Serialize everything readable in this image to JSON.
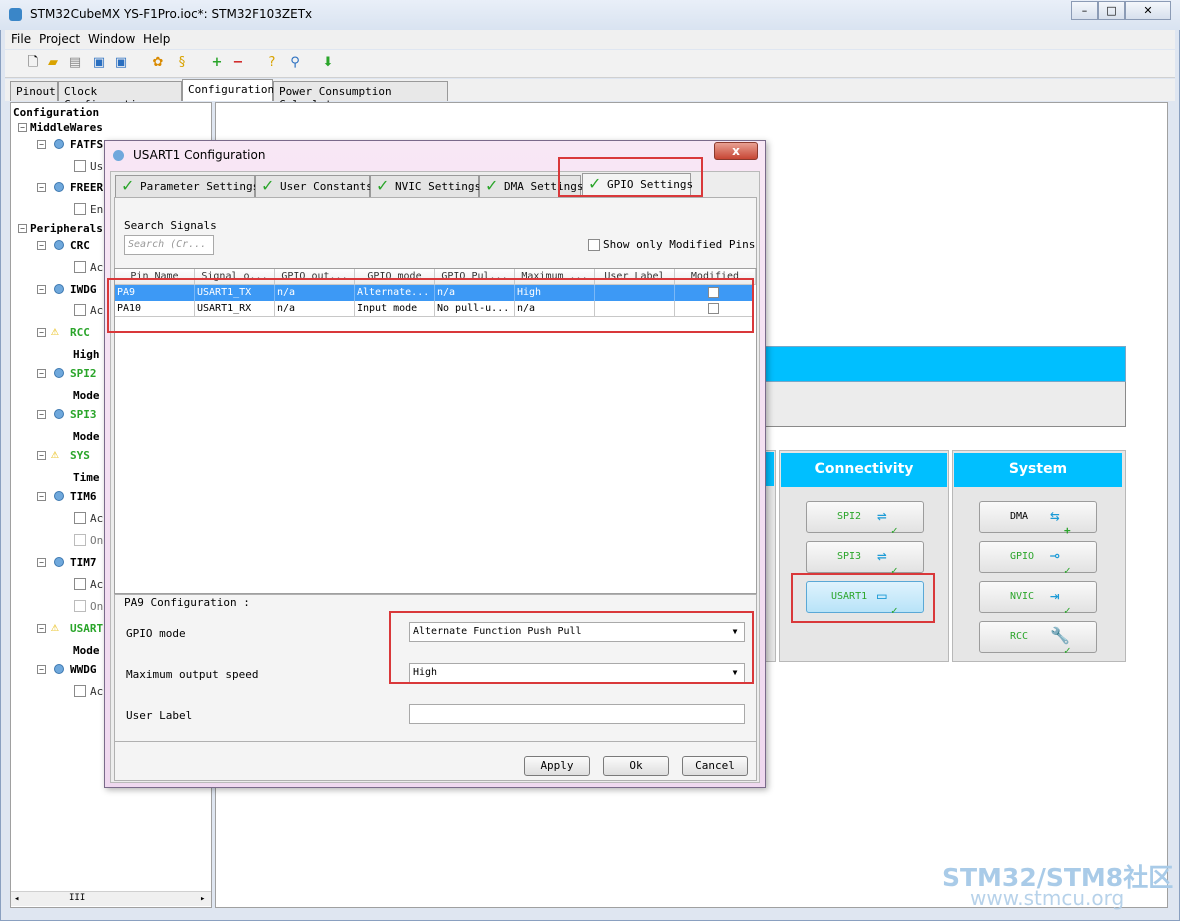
{
  "window": {
    "title": "STM32CubeMX YS-F1Pro.ioc*: STM32F103ZETx"
  },
  "menu": [
    "File",
    "Project",
    "Window",
    "Help"
  ],
  "main_tabs": [
    "Pinout",
    "Clock Configuration",
    "Configuration",
    "Power Consumption Calculator"
  ],
  "tree": {
    "root": "Configuration",
    "middlewares": "MiddleWares",
    "peripherals": "Peripherals",
    "items": [
      {
        "label": "FATFS",
        "sub": "Us"
      },
      {
        "label": "FREER",
        "sub": "En"
      },
      {
        "label": "CRC",
        "sub": "Ac"
      },
      {
        "label": "IWDG",
        "sub": "Ac"
      },
      {
        "label": "RCC",
        "sub": "High"
      },
      {
        "label": "SPI2",
        "sub": "Mode"
      },
      {
        "label": "SPI3",
        "sub": "Mode"
      },
      {
        "label": "SYS",
        "sub": "Time"
      },
      {
        "label": "TIM6",
        "sub": "Ac",
        "sub2": "On"
      },
      {
        "label": "TIM7",
        "sub": "Ac",
        "sub2": "On"
      },
      {
        "label": "USART",
        "sub": "Mode"
      },
      {
        "label": "WWDG",
        "sub": "Ac"
      }
    ],
    "scroll_thumb": "III"
  },
  "categories": {
    "connectivity": {
      "title": "Connectivity",
      "buttons": [
        "SPI2",
        "SPI3",
        "USART1"
      ]
    },
    "system": {
      "title": "System",
      "buttons": [
        "DMA",
        "GPIO",
        "NVIC",
        "RCC"
      ]
    }
  },
  "dialog": {
    "title": "USART1 Configuration",
    "close": "x",
    "tabs": [
      "Parameter Settings",
      "User Constants",
      "NVIC Settings",
      "DMA Settings",
      "GPIO Settings"
    ],
    "search_label": "Search Signals",
    "search_placeholder": "Search (Cr...",
    "show_modified": "Show only Modified Pins",
    "columns": [
      "Pin Name",
      "Signal o...",
      "GPIO out...",
      "GPIO mode",
      "GPIO Pul...",
      "Maximum ...",
      "User Label",
      "Modified"
    ],
    "rows": [
      {
        "pin": "PA9",
        "signal": "USART1_TX",
        "gpio_out": "n/a",
        "gpio_mode": "Alternate...",
        "pull": "n/a",
        "max_speed": "High",
        "label": "",
        "modified": false
      },
      {
        "pin": "PA10",
        "signal": "USART1_RX",
        "gpio_out": "n/a",
        "gpio_mode": "Input mode",
        "pull": "No pull-u...",
        "max_speed": "n/a",
        "label": "",
        "modified": false
      }
    ],
    "config_title": "PA9 Configuration :",
    "gpio_mode_label": "GPIO mode",
    "gpio_mode_value": "Alternate Function Push Pull",
    "speed_label": "Maximum output speed",
    "speed_value": "High",
    "user_label": "User Label",
    "buttons": {
      "apply": "Apply",
      "ok": "Ok",
      "cancel": "Cancel"
    }
  },
  "watermark": {
    "line1": "STM32/STM8社区",
    "line2": "www.stmcu.org"
  }
}
